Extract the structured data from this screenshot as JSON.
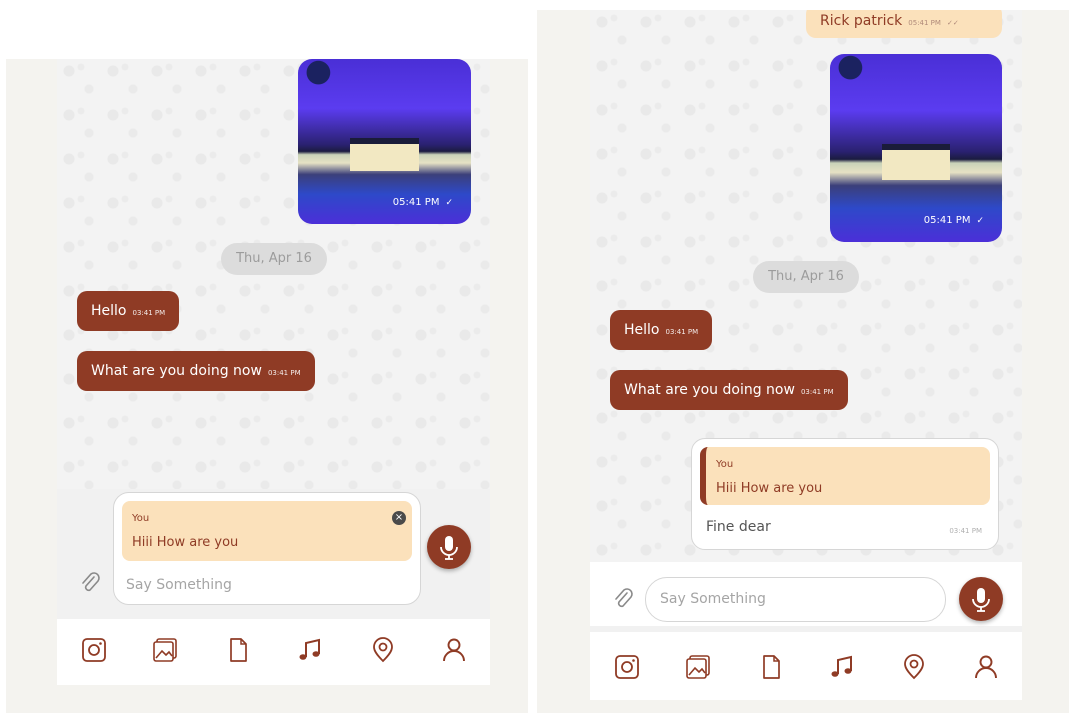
{
  "colors": {
    "accent": "#8f3b25",
    "outgoing_bubble": "#fbe1bb",
    "date_chip": "#dcdcdc"
  },
  "left": {
    "photo_time": "05:41 PM",
    "date_chip": "Thu, Apr 16",
    "messages": [
      {
        "text": "Hello",
        "time": "03:41 PM"
      },
      {
        "text": "What are you doing now",
        "time": "03:41 PM"
      }
    ],
    "reply": {
      "author": "You",
      "text": "Hiii How are you"
    },
    "input_placeholder": "Say Something"
  },
  "right": {
    "top_message": {
      "text": "Rick patrick",
      "time": "05:41 PM"
    },
    "photo_time": "05:41 PM",
    "date_chip": "Thu, Apr 16",
    "messages": [
      {
        "text": "Hello",
        "time": "03:41 PM"
      },
      {
        "text": "What are you doing now",
        "time": "03:41 PM"
      }
    ],
    "reply_message": {
      "quoted_author": "You",
      "quoted_text": "Hiii How are you",
      "text": "Fine dear",
      "time": "03:41 PM"
    },
    "input_placeholder": "Say Something"
  },
  "bottom_bar_icons": [
    "instagram-icon",
    "gallery-icon",
    "document-icon",
    "music-icon",
    "location-icon",
    "contact-icon"
  ]
}
